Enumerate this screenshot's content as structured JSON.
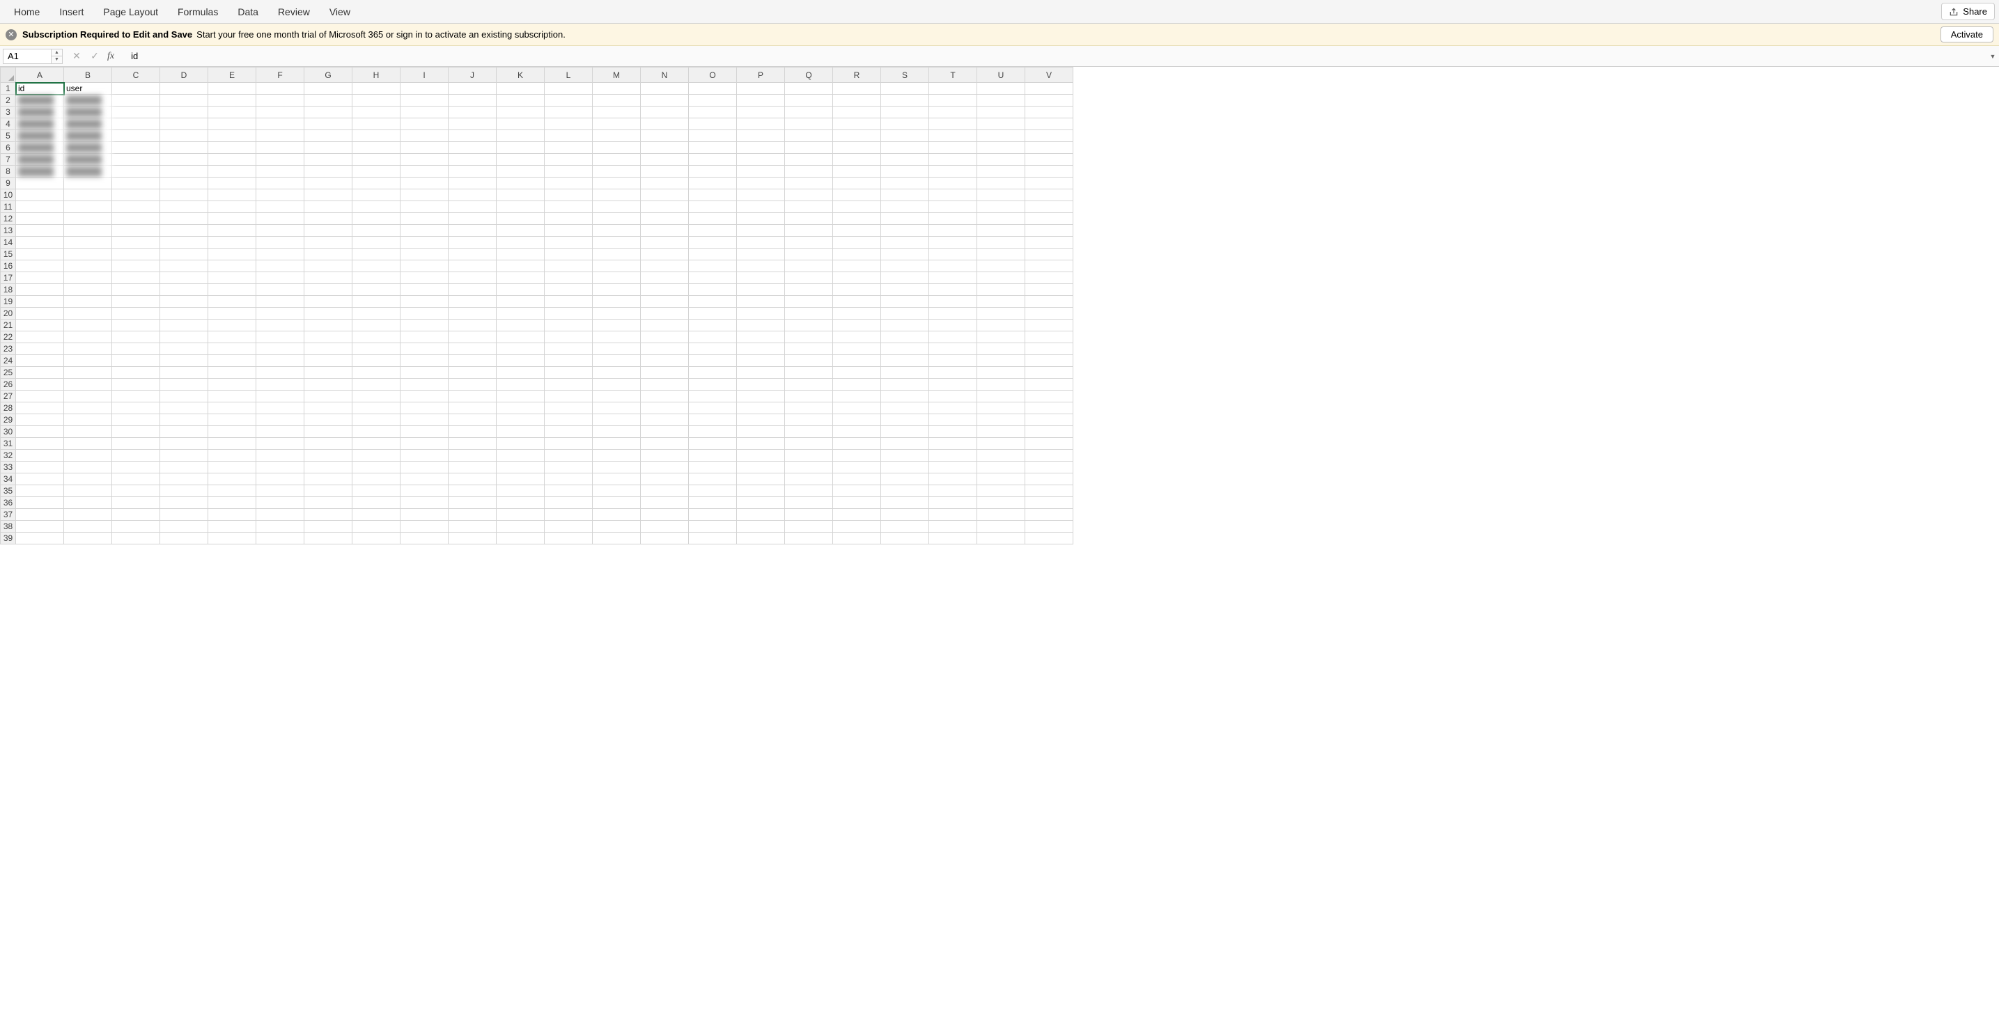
{
  "menubar": {
    "tabs": [
      "Home",
      "Insert",
      "Page Layout",
      "Formulas",
      "Data",
      "Review",
      "View"
    ],
    "share": "Share"
  },
  "notice": {
    "title": "Subscription Required to Edit and Save",
    "body": "Start your free one month trial of Microsoft 365 or sign in to activate an existing subscription.",
    "activate": "Activate"
  },
  "formula_bar": {
    "name_box": "A1",
    "formula": "id"
  },
  "columns": [
    "A",
    "B",
    "C",
    "D",
    "E",
    "F",
    "G",
    "H",
    "I",
    "J",
    "K",
    "L",
    "M",
    "N",
    "O",
    "P",
    "Q",
    "R",
    "S",
    "T",
    "U",
    "V"
  ],
  "row_count": 39,
  "selected_cell": {
    "row": 1,
    "col": 0
  },
  "cells": {
    "1": {
      "A": "id",
      "B": "user"
    },
    "2": {
      "A": "██████",
      "B": "██████"
    },
    "3": {
      "A": "██████",
      "B": "██████"
    },
    "4": {
      "A": "██████",
      "B": "██████"
    },
    "5": {
      "A": "██████",
      "B": "██████"
    },
    "6": {
      "A": "██████",
      "B": "██████"
    },
    "7": {
      "A": "██████",
      "B": "██████"
    },
    "8": {
      "A": "██████",
      "B": "██████"
    }
  },
  "blurred_rows": [
    2,
    3,
    4,
    5,
    6,
    7,
    8
  ]
}
